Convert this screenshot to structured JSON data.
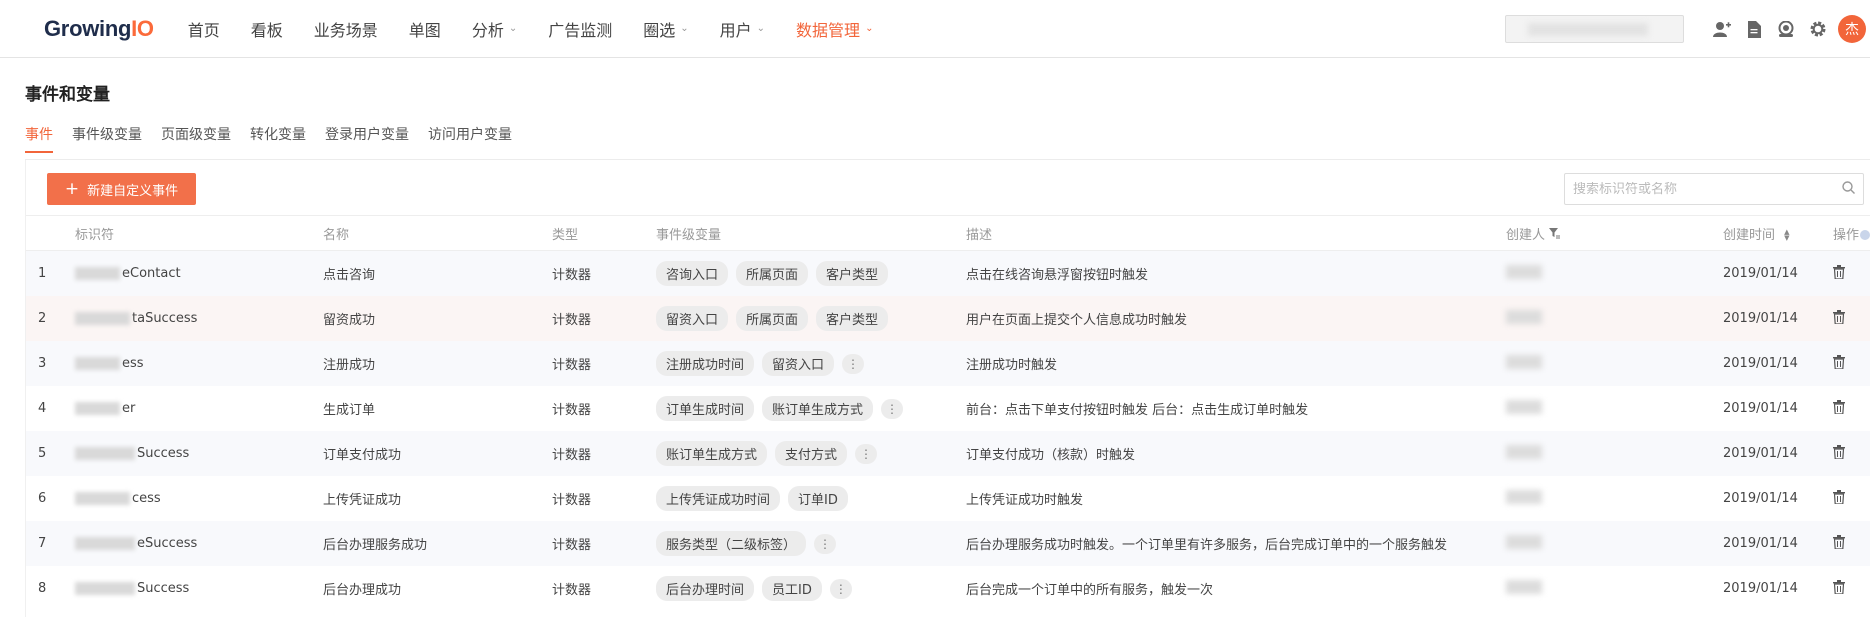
{
  "nav": {
    "logo_main": "Growing",
    "logo_accent": "IO",
    "items": [
      {
        "label": "首页",
        "caret": ""
      },
      {
        "label": "看板",
        "caret": ""
      },
      {
        "label": "业务场景",
        "caret": ""
      },
      {
        "label": "单图",
        "caret": ""
      },
      {
        "label": "分析",
        "caret": "⌄"
      },
      {
        "label": "广告监测",
        "caret": ""
      },
      {
        "label": "圈选",
        "caret": "⌄"
      },
      {
        "label": "用户",
        "caret": "⌄"
      },
      {
        "label": "数据管理",
        "caret": "⌄"
      }
    ],
    "active_index": 8,
    "avatar_text": "杰",
    "accent_color": "#f2653a"
  },
  "page": {
    "title": "事件和变量",
    "tabs": [
      "事件",
      "事件级变量",
      "页面级变量",
      "转化变量",
      "登录用户变量",
      "访问用户变量"
    ],
    "active_tab": 0
  },
  "toolbar": {
    "new_button_label": "新建自定义事件",
    "search_placeholder": "搜索标识符或名称"
  },
  "table": {
    "headers": {
      "id": "标识符",
      "name": "名称",
      "type": "类型",
      "vars": "事件级变量",
      "desc": "描述",
      "creator": "创建人",
      "time": "创建时间",
      "op": "操作"
    },
    "rows": [
      {
        "idx": "1",
        "id_suffix": "eContact",
        "name": "点击咨询",
        "type": "计数器",
        "vars": [
          "咨询入口",
          "所属页面",
          "客户类型"
        ],
        "has_more": false,
        "desc": "点击在线咨询悬浮窗按钮时触发",
        "time": "2019/01/14"
      },
      {
        "idx": "2",
        "id_suffix": "taSuccess",
        "name": "留资成功",
        "type": "计数器",
        "vars": [
          "留资入口",
          "所属页面",
          "客户类型"
        ],
        "has_more": false,
        "desc": "用户在页面上提交个人信息成功时触发",
        "time": "2019/01/14"
      },
      {
        "idx": "3",
        "id_suffix": "ess",
        "name": "注册成功",
        "type": "计数器",
        "vars": [
          "注册成功时间",
          "留资入口"
        ],
        "has_more": true,
        "desc": "注册成功时触发",
        "time": "2019/01/14"
      },
      {
        "idx": "4",
        "id_suffix": "er",
        "name": "生成订单",
        "type": "计数器",
        "vars": [
          "订单生成时间",
          "账订单生成方式"
        ],
        "has_more": true,
        "desc": "前台：点击下单支付按钮时触发 后台：点击生成订单时触发",
        "time": "2019/01/14"
      },
      {
        "idx": "5",
        "id_suffix": "Success",
        "name": "订单支付成功",
        "type": "计数器",
        "vars": [
          "账订单生成方式",
          "支付方式"
        ],
        "has_more": true,
        "desc": "订单支付成功（核款）时触发",
        "time": "2019/01/14"
      },
      {
        "idx": "6",
        "id_suffix": "cess",
        "name": "上传凭证成功",
        "type": "计数器",
        "vars": [
          "上传凭证成功时间",
          "订单ID"
        ],
        "has_more": false,
        "desc": "上传凭证成功时触发",
        "time": "2019/01/14"
      },
      {
        "idx": "7",
        "id_suffix": "eSuccess",
        "name": "后台办理服务成功",
        "type": "计数器",
        "vars": [
          "服务类型（二级标签）"
        ],
        "has_more": true,
        "desc": "后台办理服务成功时触发。一个订单里有许多服务，后台完成订单中的一个服务触发",
        "time": "2019/01/14"
      },
      {
        "idx": "8",
        "id_suffix": "Success",
        "name": "后台办理成功",
        "type": "计数器",
        "vars": [
          "后台办理时间",
          "员工ID"
        ],
        "has_more": true,
        "desc": "后台完成一个订单中的所有服务，触发一次",
        "time": "2019/01/14"
      }
    ]
  },
  "icons": {
    "add_user": "add-user-icon",
    "doc": "document-icon",
    "support": "support-icon",
    "settings": "gear-icon",
    "search": "search-icon",
    "filter": "filter-icon",
    "delete": "trash-icon"
  }
}
